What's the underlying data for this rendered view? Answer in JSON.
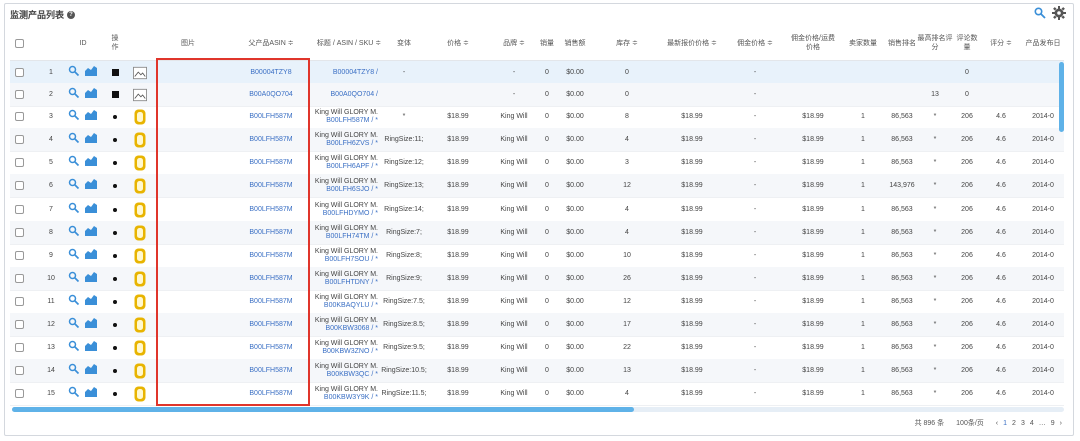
{
  "header": {
    "title": "监测产品列表",
    "help_glyph": "?"
  },
  "icons": {
    "search": "search-icon",
    "settings": "gear-icon"
  },
  "colors": {
    "link": "#3a6fc4",
    "accent": "#5fb2e8",
    "highlight_border": "#e0352b",
    "gold": "#e8b400"
  },
  "columns": [
    "ID",
    "操作",
    "",
    "图片",
    "父产品ASIN ≑",
    "标题 / ASIN / SKU ≑",
    "变体",
    "价格 ≑",
    "品牌 ≑",
    "销量",
    "销售额",
    "库存 ≑",
    "最新报价价格 ≑",
    "佣金价格 ≑",
    "佣金价格/运费价格",
    "卖家数量",
    "销售排名",
    "最高排名评分",
    "评论数量",
    "评分 ≑",
    "产品发布日"
  ],
  "rows": [
    {
      "id": "1",
      "parent": "B00004TZY8",
      "title": "",
      "asin": "B00004TZY8 /",
      "variant": "-",
      "price": "",
      "brand": "-",
      "sales": "0",
      "revenue": "$0.00",
      "stock": "0",
      "bb": "",
      "comm": "-",
      "cship": "",
      "sellers": "",
      "rank": "",
      "top": "",
      "reviews": "0",
      "rating": "",
      "date": ""
    },
    {
      "id": "2",
      "parent": "B00A0QO704",
      "title": "",
      "asin": "B00A0QO704 /",
      "variant": "",
      "price": "",
      "brand": "-",
      "sales": "0",
      "revenue": "$0.00",
      "stock": "0",
      "bb": "",
      "comm": "-",
      "cship": "",
      "sellers": "",
      "rank": "",
      "top": "13",
      "reviews": "0",
      "rating": "",
      "date": ""
    },
    {
      "id": "3",
      "parent": "B00LFH587M",
      "title": "King Will GLORY M.",
      "asin": "B00LFH587M / *",
      "variant": "*",
      "price": "$18.99",
      "brand": "King Will",
      "sales": "0",
      "revenue": "$0.00",
      "stock": "8",
      "bb": "$18.99",
      "comm": "-",
      "cship": "$18.99",
      "sellers": "1",
      "rank": "86,563",
      "top": "*",
      "reviews": "206",
      "rating": "4.6",
      "date": "2014-0"
    },
    {
      "id": "4",
      "parent": "B00LFH587M",
      "title": "King Will GLORY M.",
      "asin": "B00LFH6ZVS / *",
      "variant": "RingSize:11;",
      "price": "$18.99",
      "brand": "King Will",
      "sales": "0",
      "revenue": "$0.00",
      "stock": "4",
      "bb": "$18.99",
      "comm": "-",
      "cship": "$18.99",
      "sellers": "1",
      "rank": "86,563",
      "top": "*",
      "reviews": "206",
      "rating": "4.6",
      "date": "2014-0"
    },
    {
      "id": "5",
      "parent": "B00LFH587M",
      "title": "King Will GLORY M.",
      "asin": "B00LFH6APF / *",
      "variant": "RingSize:12;",
      "price": "$18.99",
      "brand": "King Will",
      "sales": "0",
      "revenue": "$0.00",
      "stock": "3",
      "bb": "$18.99",
      "comm": "-",
      "cship": "$18.99",
      "sellers": "1",
      "rank": "86,563",
      "top": "*",
      "reviews": "206",
      "rating": "4.6",
      "date": "2014-0"
    },
    {
      "id": "6",
      "parent": "B00LFH587M",
      "title": "King Will GLORY M.",
      "asin": "B00LFH6SJO / *",
      "variant": "RingSize:13;",
      "price": "$18.99",
      "brand": "King Will",
      "sales": "0",
      "revenue": "$0.00",
      "stock": "12",
      "bb": "$18.99",
      "comm": "-",
      "cship": "$18.99",
      "sellers": "1",
      "rank": "143,976",
      "top": "*",
      "reviews": "206",
      "rating": "4.6",
      "date": "2014-0"
    },
    {
      "id": "7",
      "parent": "B00LFH587M",
      "title": "King Will GLORY M.",
      "asin": "B00LFHDYMO / *",
      "variant": "RingSize:14;",
      "price": "$18.99",
      "brand": "King Will",
      "sales": "0",
      "revenue": "$0.00",
      "stock": "4",
      "bb": "$18.99",
      "comm": "-",
      "cship": "$18.99",
      "sellers": "1",
      "rank": "86,563",
      "top": "*",
      "reviews": "206",
      "rating": "4.6",
      "date": "2014-0"
    },
    {
      "id": "8",
      "parent": "B00LFH587M",
      "title": "King Will GLORY M.",
      "asin": "B00LFH74TM / *",
      "variant": "RingSize:7;",
      "price": "$18.99",
      "brand": "King Will",
      "sales": "0",
      "revenue": "$0.00",
      "stock": "4",
      "bb": "$18.99",
      "comm": "-",
      "cship": "$18.99",
      "sellers": "1",
      "rank": "86,563",
      "top": "*",
      "reviews": "206",
      "rating": "4.6",
      "date": "2014-0"
    },
    {
      "id": "9",
      "parent": "B00LFH587M",
      "title": "King Will GLORY M.",
      "asin": "B00LFH7SOU / *",
      "variant": "RingSize:8;",
      "price": "$18.99",
      "brand": "King Will",
      "sales": "0",
      "revenue": "$0.00",
      "stock": "10",
      "bb": "$18.99",
      "comm": "-",
      "cship": "$18.99",
      "sellers": "1",
      "rank": "86,563",
      "top": "*",
      "reviews": "206",
      "rating": "4.6",
      "date": "2014-0"
    },
    {
      "id": "10",
      "parent": "B00LFH587M",
      "title": "King Will GLORY M.",
      "asin": "B00LFHTDNY / *",
      "variant": "RingSize:9;",
      "price": "$18.99",
      "brand": "King Will",
      "sales": "0",
      "revenue": "$0.00",
      "stock": "26",
      "bb": "$18.99",
      "comm": "-",
      "cship": "$18.99",
      "sellers": "1",
      "rank": "86,563",
      "top": "*",
      "reviews": "206",
      "rating": "4.6",
      "date": "2014-0"
    },
    {
      "id": "11",
      "parent": "B00LFH587M",
      "title": "King Will GLORY M.",
      "asin": "B00KBAQYLU / *",
      "variant": "RingSize:7.5;",
      "price": "$18.99",
      "brand": "King Will",
      "sales": "0",
      "revenue": "$0.00",
      "stock": "12",
      "bb": "$18.99",
      "comm": "-",
      "cship": "$18.99",
      "sellers": "1",
      "rank": "86,563",
      "top": "*",
      "reviews": "206",
      "rating": "4.6",
      "date": "2014-0"
    },
    {
      "id": "12",
      "parent": "B00LFH587M",
      "title": "King Will GLORY M.",
      "asin": "B00KBW3068 / *",
      "variant": "RingSize:8.5;",
      "price": "$18.99",
      "brand": "King Will",
      "sales": "0",
      "revenue": "$0.00",
      "stock": "17",
      "bb": "$18.99",
      "comm": "-",
      "cship": "$18.99",
      "sellers": "1",
      "rank": "86,563",
      "top": "*",
      "reviews": "206",
      "rating": "4.6",
      "date": "2014-0"
    },
    {
      "id": "13",
      "parent": "B00LFH587M",
      "title": "King Will GLORY M.",
      "asin": "B00KBW3ZNO / *",
      "variant": "RingSize:9.5;",
      "price": "$18.99",
      "brand": "King Will",
      "sales": "0",
      "revenue": "$0.00",
      "stock": "22",
      "bb": "$18.99",
      "comm": "-",
      "cship": "$18.99",
      "sellers": "1",
      "rank": "86,563",
      "top": "*",
      "reviews": "206",
      "rating": "4.6",
      "date": "2014-0"
    },
    {
      "id": "14",
      "parent": "B00LFH587M",
      "title": "King Will GLORY M.",
      "asin": "B00KBW3QC / *",
      "variant": "RingSize:10.5;",
      "price": "$18.99",
      "brand": "King Will",
      "sales": "0",
      "revenue": "$0.00",
      "stock": "13",
      "bb": "$18.99",
      "comm": "-",
      "cship": "$18.99",
      "sellers": "1",
      "rank": "86,563",
      "top": "*",
      "reviews": "206",
      "rating": "4.6",
      "date": "2014-0"
    },
    {
      "id": "15",
      "parent": "B00LFH587M",
      "title": "King Will GLORY M.",
      "asin": "B00KBW3Y9K / *",
      "variant": "RingSize:11.5;",
      "price": "$18.99",
      "brand": "King Will",
      "sales": "0",
      "revenue": "$0.00",
      "stock": "4",
      "bb": "$18.99",
      "comm": "-",
      "cship": "$18.99",
      "sellers": "1",
      "rank": "86,563",
      "top": "*",
      "reviews": "206",
      "rating": "4.6",
      "date": "2014-0"
    }
  ],
  "footer": {
    "total": "共 896 条",
    "per_page": "100条/页",
    "prev": "‹",
    "pages": [
      "1",
      "2",
      "3",
      "4"
    ],
    "ellipsis": "…",
    "last": "9",
    "next": "›"
  }
}
